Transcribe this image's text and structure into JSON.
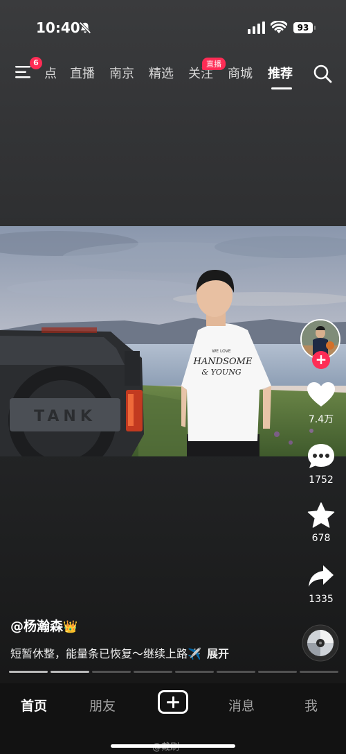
{
  "status_bar": {
    "time": "10:40",
    "battery": "93"
  },
  "top_nav": {
    "menu_badge": "6",
    "tabs": [
      {
        "label": "点"
      },
      {
        "label": "直播"
      },
      {
        "label": "南京"
      },
      {
        "label": "精选"
      },
      {
        "label": "关注"
      },
      {
        "label": "商城"
      },
      {
        "label": "推荐"
      }
    ],
    "active_tab": "推荐",
    "live_badge": "直播"
  },
  "video": {
    "shirt_text_line1": "WE LOVE",
    "shirt_text_line2": "HANDSOME",
    "shirt_text_line3": "& YOUNG",
    "plate_text": "TANK"
  },
  "right_rail": {
    "likes": "7.4万",
    "comments": "1752",
    "favorites": "678",
    "shares": "1335"
  },
  "post": {
    "author": "@杨瀚森",
    "author_emoji": "👑",
    "caption": "短暂休整，能量条已恢复～继续上路✈️",
    "expand_label": "展开",
    "progress_segments": 8,
    "progress_done": 2
  },
  "bottom_nav": {
    "home": "首页",
    "friends": "朋友",
    "messages": "消息",
    "me": "我"
  },
  "watermark": "@戴刷",
  "colors": {
    "accent": "#fe2c55",
    "background": "#1f2021"
  }
}
